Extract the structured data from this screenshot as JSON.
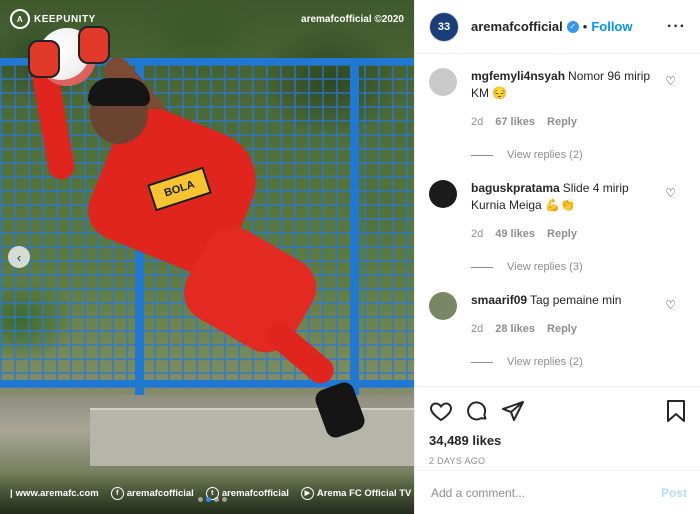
{
  "photo": {
    "brand": "KEEPUNITY",
    "copyright": "aremafcofficial ©2020",
    "jersey_sponsor": "BOLA",
    "bottom_links": [
      {
        "icon": "globe-icon",
        "label": "www.aremafc.com"
      },
      {
        "icon": "facebook-icon",
        "label": "aremafcofficial"
      },
      {
        "icon": "twitter-icon",
        "label": "aremafcofficial"
      },
      {
        "icon": "tv-icon",
        "label": "Arema FC Official TV"
      }
    ],
    "carousel": {
      "count": 4,
      "active_index": 1
    },
    "prev_icon": "chevron-left-icon"
  },
  "header": {
    "username": "aremafcofficial",
    "avatar_text": "33",
    "separator": "•",
    "follow_label": "Follow",
    "more_icon": "more-horizontal-icon"
  },
  "comments": [
    {
      "user": "mgfemyli4nsyah",
      "text": "Nomor 96 mirip KM 😔",
      "time": "2d",
      "likes": "67 likes",
      "reply": "Reply",
      "view_replies": "View replies (2)",
      "avatar_color": "#c9c9c9"
    },
    {
      "user": "baguskpratama",
      "text": "Slide 4 mirip Kurnia Meiga 💪👏",
      "time": "2d",
      "likes": "49 likes",
      "reply": "Reply",
      "view_replies": "View replies (3)",
      "avatar_color": "#1b1b1b"
    },
    {
      "user": "smaarif09",
      "text": "Tag pemaine min",
      "time": "2d",
      "likes": "28 likes",
      "reply": "Reply",
      "view_replies": "View replies (2)",
      "avatar_color": "#7a8766"
    }
  ],
  "actions": {
    "likes": "34,489 likes",
    "date": "2 DAYS AGO"
  },
  "add_comment": {
    "placeholder": "Add a comment...",
    "post_label": "Post"
  },
  "colors": {
    "accent": "#0095f6",
    "brand_blue": "#1a3e7a",
    "jersey_red": "#e0241e"
  }
}
